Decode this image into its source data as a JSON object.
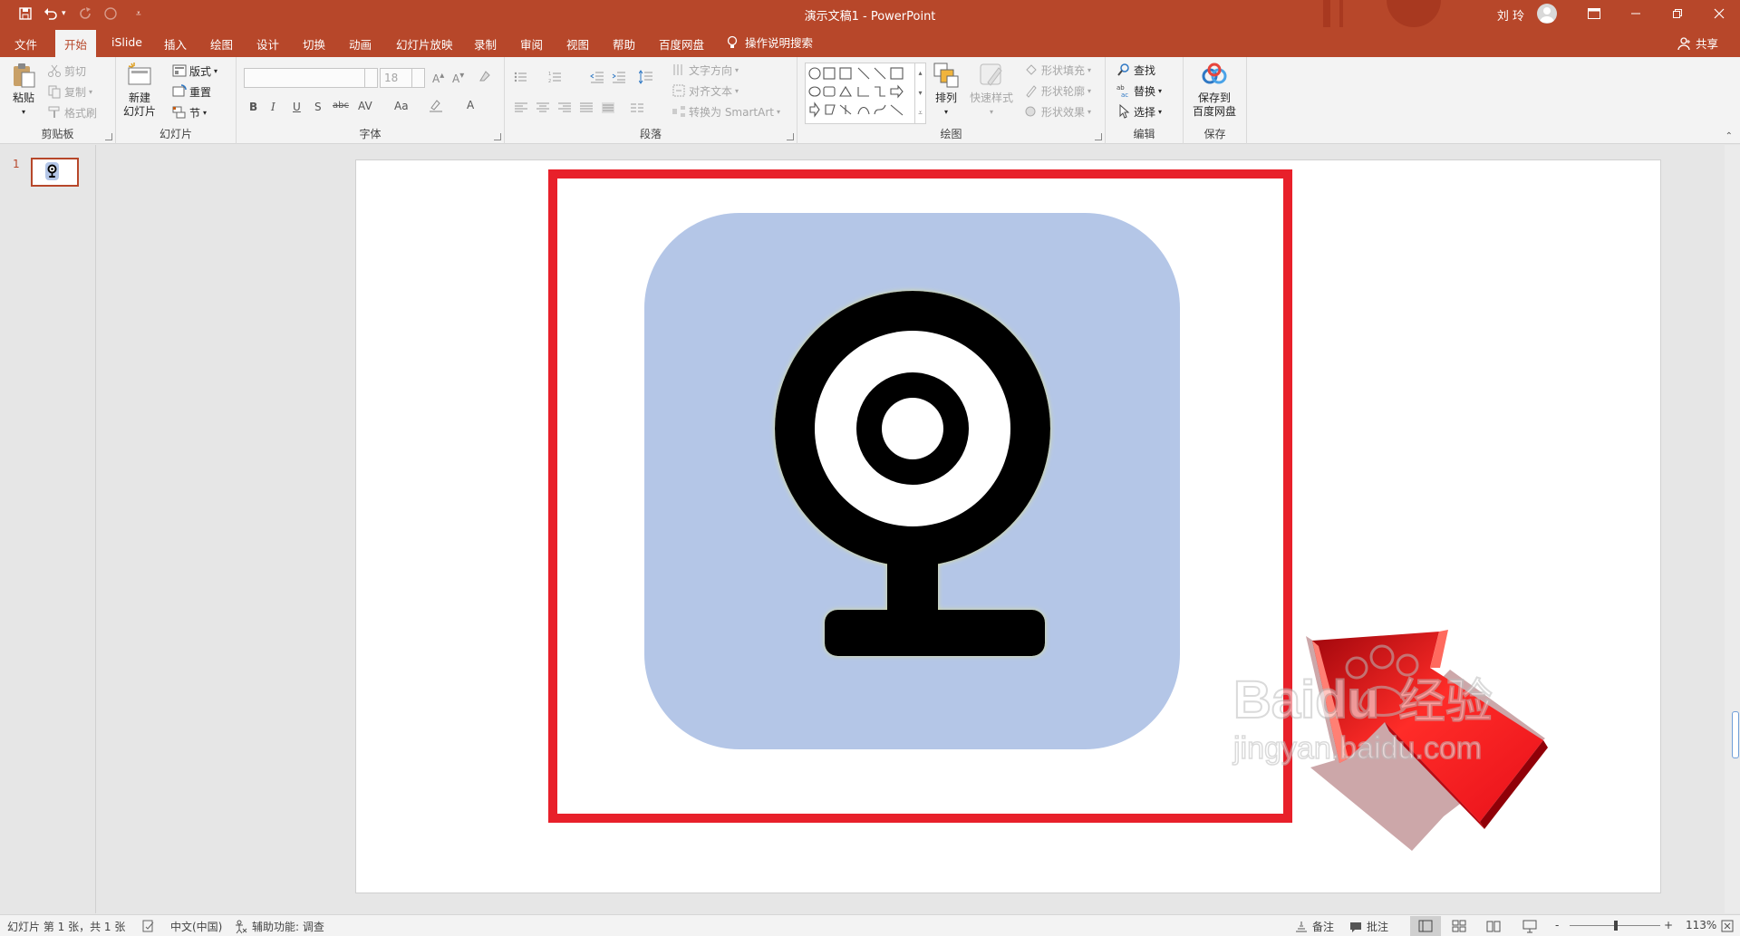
{
  "titlebar": {
    "doc_title": "演示文稿1 - PowerPoint",
    "user_name": "刘 玲"
  },
  "tabs": [
    {
      "label": "文件"
    },
    {
      "label": "开始",
      "active": true
    },
    {
      "label": "iSlide"
    },
    {
      "label": "插入"
    },
    {
      "label": "绘图"
    },
    {
      "label": "设计"
    },
    {
      "label": "切换"
    },
    {
      "label": "动画"
    },
    {
      "label": "幻灯片放映"
    },
    {
      "label": "录制"
    },
    {
      "label": "审阅"
    },
    {
      "label": "视图"
    },
    {
      "label": "帮助"
    },
    {
      "label": "百度网盘"
    }
  ],
  "tell_me": "操作说明搜索",
  "share": "共享",
  "ribbon": {
    "clipboard": {
      "label": "剪贴板",
      "paste": "粘贴",
      "cut": "剪切",
      "copy": "复制",
      "format_painter": "格式刷"
    },
    "slides": {
      "label": "幻灯片",
      "new_slide_line1": "新建",
      "new_slide_line2": "幻灯片",
      "layout": "版式",
      "reset": "重置",
      "section": "节"
    },
    "font": {
      "label": "字体",
      "font_name": "",
      "font_size": "18",
      "bold": "B",
      "italic": "I",
      "underline": "U",
      "shadow": "S",
      "strike": "abc",
      "spacing": "AV",
      "case": "Aa",
      "font_color": "A"
    },
    "paragraph": {
      "label": "段落",
      "text_direction": "文字方向",
      "align_text": "对齐文本",
      "smartart": "转换为 SmartArt"
    },
    "drawing": {
      "label": "绘图",
      "arrange": "排列",
      "quick_styles": "快速样式",
      "shape_fill": "形状填充",
      "shape_outline": "形状轮廓",
      "shape_effects": "形状效果"
    },
    "editing": {
      "label": "编辑",
      "find": "查找",
      "replace": "替换",
      "select": "选择"
    },
    "save": {
      "label": "保存",
      "line1": "保存到",
      "line2": "百度网盘"
    }
  },
  "thumbnails": [
    {
      "number": "1"
    }
  ],
  "watermark": {
    "brand": "Baidu",
    "brand_suffix": "经验",
    "url": "jingyan.baidu.com"
  },
  "statusbar": {
    "slide_info": "幻灯片 第 1 张，共 1 张",
    "language": "中文(中国)",
    "accessibility": "辅助功能: 调查",
    "notes": "备注",
    "comments": "批注",
    "zoom_minus": "-",
    "zoom_plus": "+",
    "zoom": "113%"
  },
  "colors": {
    "accent": "#b7472a",
    "highlight_box": "#e8202a",
    "icon_bg": "#b4c6e7",
    "arrow": "#e8101a"
  },
  "icons": {
    "slide_content": "webcam-icon",
    "annotation": "red-3d-arrow"
  }
}
